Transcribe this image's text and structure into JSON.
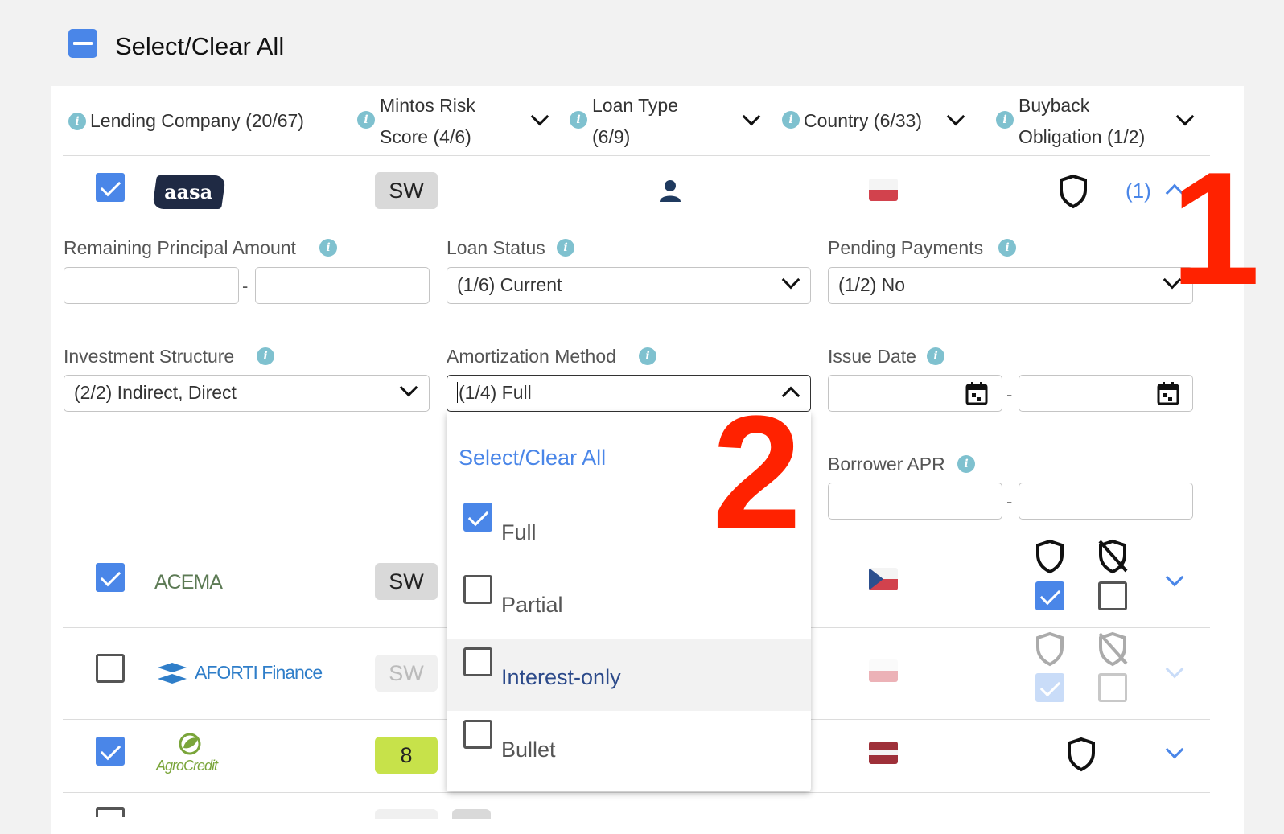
{
  "select_all": {
    "label": "Select/Clear All"
  },
  "headers": [
    {
      "label": "Lending Company (20/67)"
    },
    {
      "label_line1": "Mintos Risk",
      "label_line2": "Score (4/6)"
    },
    {
      "label_line1": "Loan Type",
      "label_line2": "(6/9)"
    },
    {
      "label": "Country (6/33)"
    },
    {
      "label_line1": "Buyback",
      "label_line2": "Obligation (1/2)"
    }
  ],
  "rows": [
    {
      "company": "aasa",
      "checked": true,
      "risk": "SW",
      "expand_count": "(1)",
      "country_flag": "Poland"
    },
    {
      "company": "ACEMA",
      "checked": true,
      "risk": "SW",
      "country_flag": "Czech Republic"
    },
    {
      "company": "AFORTI Finance",
      "checked": false,
      "risk": "SW",
      "country_flag": "Poland"
    },
    {
      "company": "AgroCredit",
      "checked": true,
      "risk": "8",
      "country_flag": "Latvia"
    }
  ],
  "filters": {
    "remaining_principal": {
      "label": "Remaining Principal Amount",
      "from": "",
      "to": ""
    },
    "loan_status": {
      "label": "Loan Status",
      "value": "(1/6) Current"
    },
    "pending_payments": {
      "label": "Pending Payments",
      "value": "(1/2) No"
    },
    "investment_structure": {
      "label": "Investment Structure",
      "value": "(2/2) Indirect, Direct"
    },
    "amortization_method": {
      "label": "Amortization Method",
      "value": "(1/4) Full"
    },
    "issue_date": {
      "label": "Issue Date",
      "from": "",
      "to": ""
    },
    "borrower_apr": {
      "label": "Borrower APR",
      "from": "",
      "to": ""
    }
  },
  "dropdown": {
    "select_all": "Select/Clear All",
    "options": [
      {
        "label": "Full",
        "checked": true
      },
      {
        "label": "Partial",
        "checked": false
      },
      {
        "label": "Interest-only",
        "checked": false,
        "hovered": true
      },
      {
        "label": "Bullet",
        "checked": false
      }
    ]
  },
  "annotations": {
    "one": "1",
    "two": "2"
  },
  "colors": {
    "accent": "#4a86e8",
    "annotation": "#ff2200",
    "risk_green": "#c7e24a"
  }
}
